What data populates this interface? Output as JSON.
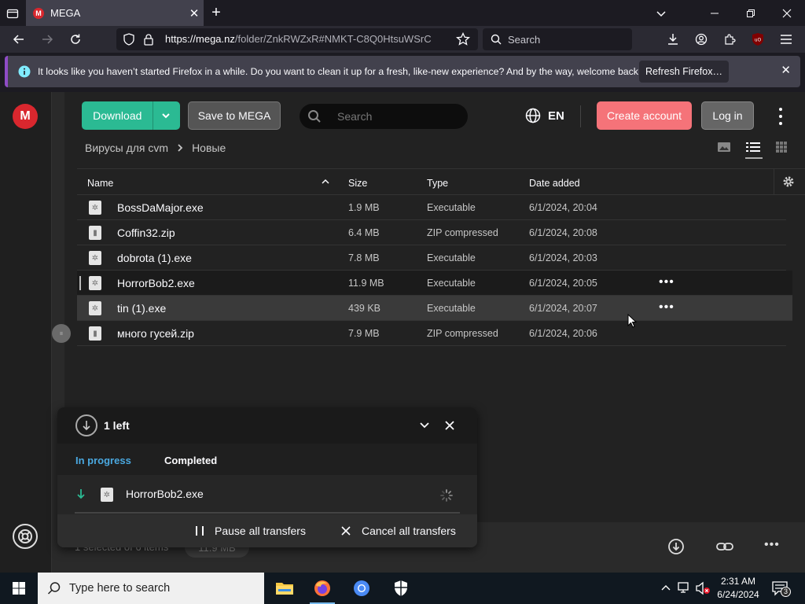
{
  "browser": {
    "tab_title": "MEGA",
    "tab_favicon": "M",
    "url_host": "https://mega.nz",
    "url_path": "/folder/ZnkRWZxR#NMKT-C8Q0HtsuWSrC",
    "search_placeholder": "Search",
    "notification": {
      "message": "It looks like you haven’t started Firefox in a while. Do you want to clean it up for a fresh, like-new experience? And by the way, welcome back!",
      "button": "Refresh Firefox…"
    },
    "colors": {
      "frame": "#1c1b22",
      "toolbar": "#2b2a33",
      "accent": "#8f4cc6"
    }
  },
  "mega": {
    "logo": "M",
    "download_label": "Download",
    "save_label": "Save to MEGA",
    "search_placeholder": "Search",
    "language": "EN",
    "create_account": "Create account",
    "login": "Log in",
    "breadcrumb": [
      "Вирусы для cvm",
      "Новые"
    ],
    "columns": {
      "name": "Name",
      "size": "Size",
      "type": "Type",
      "date": "Date added"
    },
    "files": [
      {
        "name": "BossDaMajor.exe",
        "size": "1.9 MB",
        "type": "Executable",
        "date": "6/1/2024, 20:04",
        "icon": "exe-file-icon"
      },
      {
        "name": "Coffin32.zip",
        "size": "6.4 MB",
        "type": "ZIP compressed",
        "date": "6/1/2024, 20:08",
        "icon": "zip-file-icon"
      },
      {
        "name": "dobrota (1).exe",
        "size": "7.8 MB",
        "type": "Executable",
        "date": "6/1/2024, 20:03",
        "icon": "exe-file-icon"
      },
      {
        "name": "HorrorBob2.exe",
        "size": "11.9 MB",
        "type": "Executable",
        "date": "6/1/2024, 20:05",
        "icon": "exe-file-icon"
      },
      {
        "name": "tin (1).exe",
        "size": "439 KB",
        "type": "Executable",
        "date": "6/1/2024, 20:07",
        "icon": "exe-file-icon"
      },
      {
        "name": "много гусей.zip",
        "size": "7.9 MB",
        "type": "ZIP compressed",
        "date": "6/1/2024, 20:06",
        "icon": "zip-file-icon"
      }
    ],
    "selection_info": "1 selected of 6 items",
    "selection_size": "11.9 MB",
    "transfers": {
      "remaining": "1 left",
      "tab_in_progress": "In progress",
      "tab_completed": "Completed",
      "item_name": "HorrorBob2.exe",
      "pause_all": "Pause all transfers",
      "cancel_all": "Cancel all transfers"
    },
    "colors": {
      "download": "#2bba93",
      "create": "#f57379",
      "brand": "#d9272e",
      "tab_active": "#4aa8e0"
    }
  },
  "taskbar": {
    "search_placeholder": "Type here to search",
    "time": "2:31 AM",
    "date": "6/24/2024",
    "notification_count": "3"
  }
}
